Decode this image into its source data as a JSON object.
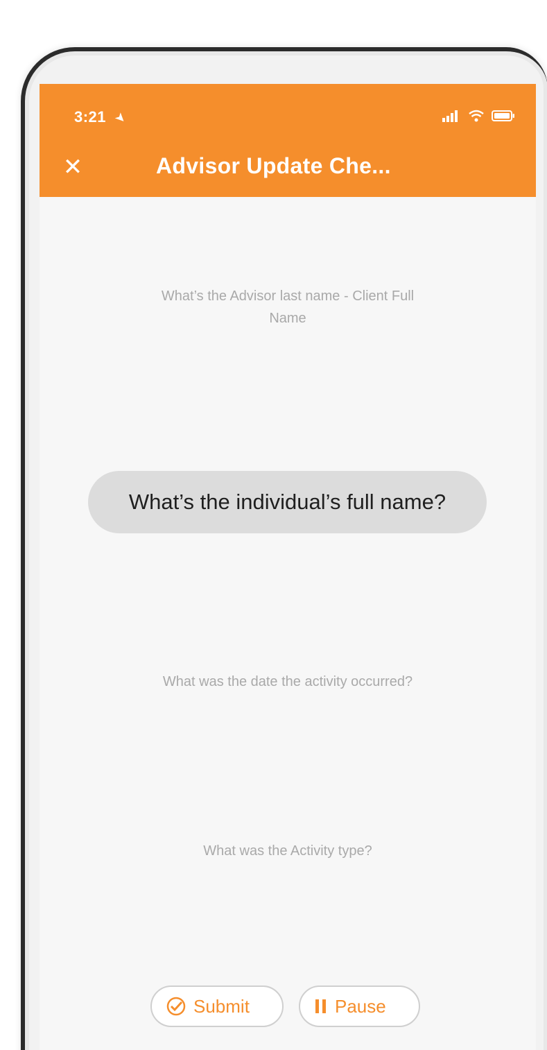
{
  "status_bar": {
    "time": "3:21",
    "icons": [
      "location-arrow-icon",
      "signal-icon",
      "wifi-icon",
      "battery-icon"
    ]
  },
  "header": {
    "title": "Advisor Update Che...",
    "close_glyph": "✕"
  },
  "questions": {
    "q1": "What’s the Advisor last name - Client Full Name",
    "active": "What’s the individual’s full name?",
    "q3": "What was the date the activity occurred?",
    "q4": "What was the Activity type?"
  },
  "actions": {
    "submit_label": "Submit",
    "pause_label": "Pause"
  },
  "colors": {
    "accent": "#f58e2c",
    "active_pill": "#dcdcdc",
    "muted_text": "#a9a9a9"
  }
}
